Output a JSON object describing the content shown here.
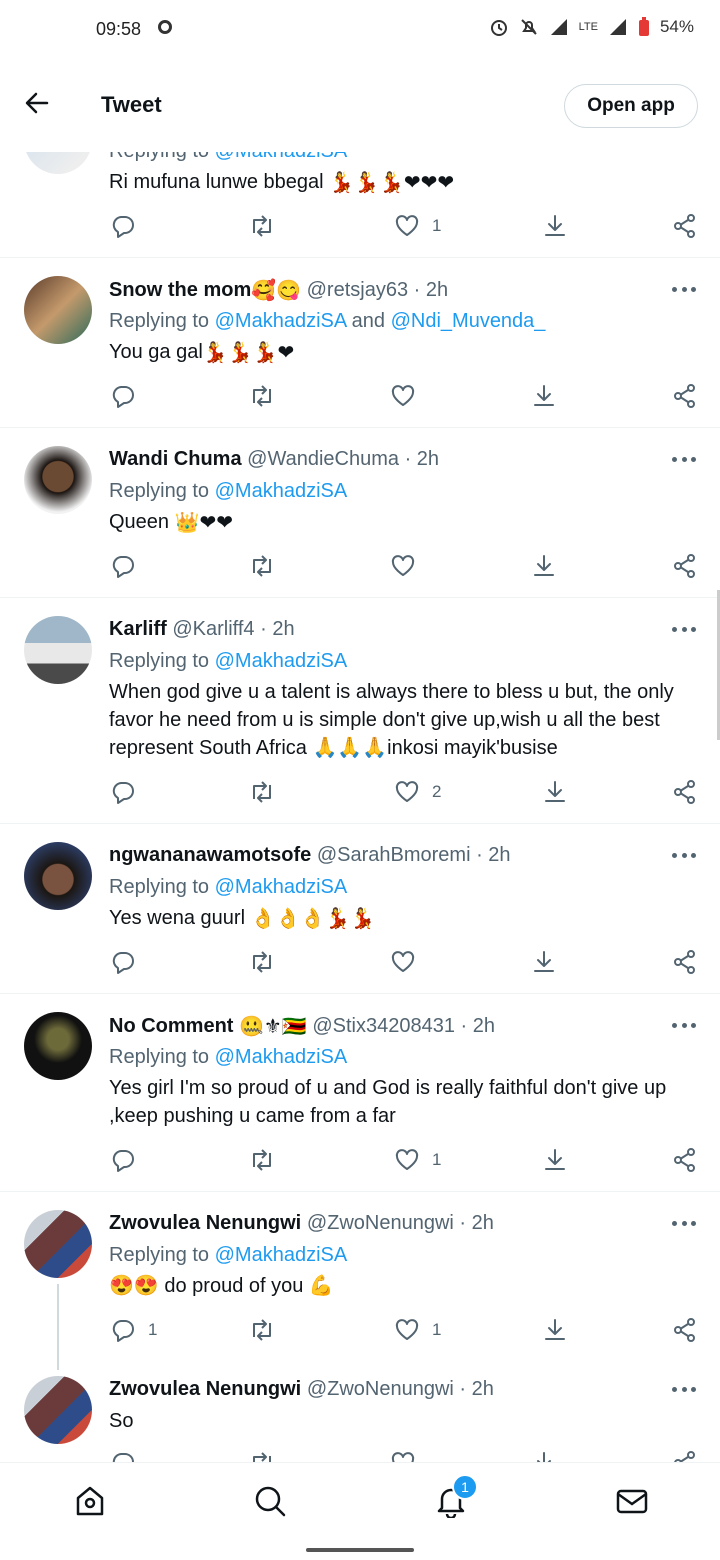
{
  "status_bar": {
    "time": "09:58",
    "network": "LTE",
    "battery": "54%"
  },
  "header": {
    "title": "Tweet",
    "open_app_label": "Open app"
  },
  "tweets": [
    {
      "name": "",
      "handle": "",
      "time": "",
      "reply_prefix": "Replying to ",
      "mentions": [
        "@MakhadziSA"
      ],
      "conj": "",
      "text": "Ri mufuna lunwe bbegal",
      "emoji": "💃💃💃❤❤❤",
      "counts": {
        "replies": "",
        "retweets": "",
        "likes": "1"
      }
    },
    {
      "name": "Snow the mom",
      "name_emoji": "🥰😋",
      "handle": "@retsjay63",
      "time": "· 2h",
      "reply_prefix": "Replying to ",
      "mentions": [
        "@MakhadziSA",
        "@Ndi_Muvenda_"
      ],
      "conj": " and ",
      "text": "You ga gal",
      "emoji": "💃💃💃❤",
      "counts": {
        "replies": "",
        "retweets": "",
        "likes": ""
      }
    },
    {
      "name": "Wandi Chuma",
      "name_emoji": "",
      "handle": "@WandieChuma",
      "time": "· 2h",
      "reply_prefix": "Replying to ",
      "mentions": [
        "@MakhadziSA"
      ],
      "conj": "",
      "text": "Queen",
      "emoji": "👑❤❤",
      "counts": {
        "replies": "",
        "retweets": "",
        "likes": ""
      }
    },
    {
      "name": "Karliff",
      "name_emoji": "",
      "handle": "@Karliff4",
      "time": "· 2h",
      "reply_prefix": "Replying to ",
      "mentions": [
        "@MakhadziSA"
      ],
      "conj": "",
      "text": "When god give u a talent is always there to bless u but, the only favor he need from u is simple don't give up,wish u all the best represent South Africa 🙏🙏🙏inkosi mayik'busise",
      "emoji": "",
      "counts": {
        "replies": "",
        "retweets": "",
        "likes": "2"
      }
    },
    {
      "name": "ngwananawamotsofe",
      "name_emoji": "",
      "handle": "@SarahBmoremi",
      "time": "· 2h",
      "reply_prefix": "Replying to ",
      "mentions": [
        "@MakhadziSA"
      ],
      "conj": "",
      "text": "Yes wena guurl",
      "emoji": "👌👌👌💃💃",
      "counts": {
        "replies": "",
        "retweets": "",
        "likes": ""
      }
    },
    {
      "name": "No Comment",
      "name_emoji": "🤐⚜🇿🇼",
      "handle": "@Stix34208431",
      "time": "· 2h",
      "reply_prefix": "Replying to ",
      "mentions": [
        "@MakhadziSA"
      ],
      "conj": "",
      "text": "Yes girl I'm so proud of u and God is really faithful don't give up ,keep pushing u came from  a far",
      "emoji": "",
      "counts": {
        "replies": "",
        "retweets": "",
        "likes": "1"
      }
    },
    {
      "name": "Zwovulea Nenungwi",
      "name_emoji": "",
      "handle": "@ZwoNenungwi",
      "time": "· 2h",
      "reply_prefix": "Replying to ",
      "mentions": [
        "@MakhadziSA"
      ],
      "conj": "",
      "text": "😍😍 do proud of you 💪",
      "emoji": "",
      "counts": {
        "replies": "1",
        "retweets": "",
        "likes": "1"
      }
    },
    {
      "name": "Zwovulea Nenungwi",
      "name_emoji": "",
      "handle": "@ZwoNenungwi",
      "time": "· 2h",
      "reply_prefix": "",
      "mentions": [],
      "conj": "",
      "text": "So",
      "emoji": "",
      "counts": {
        "replies": "",
        "retweets": "",
        "likes": ""
      }
    }
  ],
  "bottom_nav": {
    "notifications_badge": "1"
  },
  "colors": {
    "accent": "#1d9bf0",
    "muted": "#536471",
    "heart_red": "#d0021b"
  },
  "icons": [
    "arrow-left-icon",
    "reply-icon",
    "retweet-icon",
    "heart-icon",
    "download-icon",
    "share-icon",
    "more-icon",
    "home-icon",
    "search-icon",
    "bell-icon",
    "mail-icon"
  ]
}
